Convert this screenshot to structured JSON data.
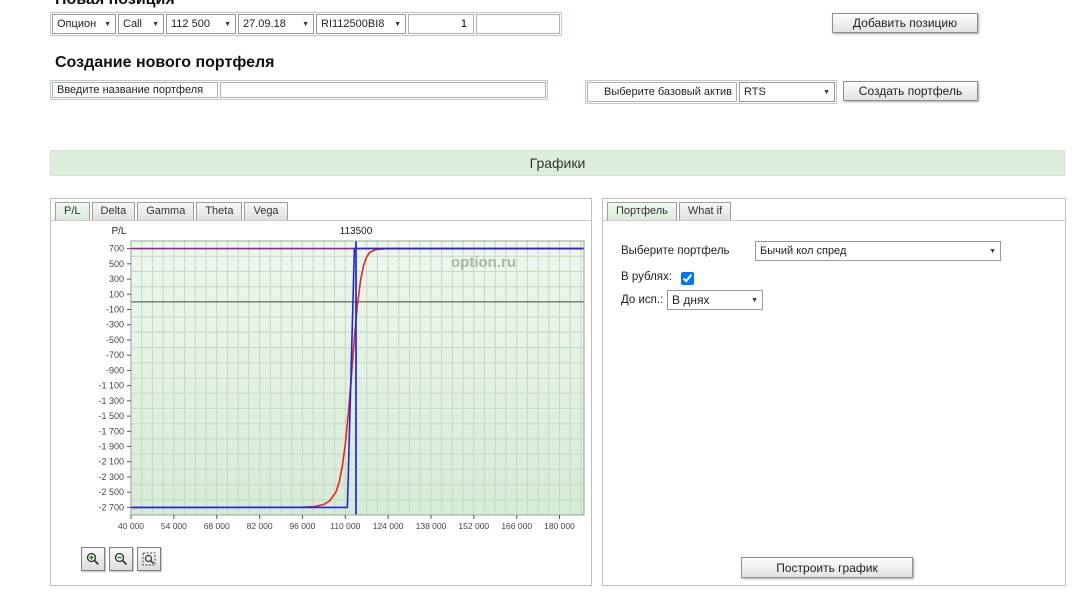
{
  "new_position": {
    "title": "Новая позиция",
    "type": "Опцион",
    "direction": "Call",
    "strike": "112 500",
    "expiry": "27.09.18",
    "code": "RI112500BI8",
    "quantity": "1",
    "add_button": "Добавить позицию"
  },
  "new_portfolio": {
    "title": "Создание нового портфеля",
    "name_label": "Введите название портфеля",
    "name_value": "",
    "base_asset_label": "Выберите базовый актив",
    "base_asset": "RTS",
    "create_button": "Создать портфель"
  },
  "charts_section": {
    "title": "Графики"
  },
  "chart_tabs": [
    "P/L",
    "Delta",
    "Gamma",
    "Theta",
    "Vega"
  ],
  "right_tabs": [
    "Портфель",
    "What if"
  ],
  "portfolio_panel": {
    "select_label": "Выберите портфель",
    "portfolio_value": "Бычий кол спред",
    "rubles_label": "В рублях:",
    "rubles_checked": true,
    "days_label": "До исп.:",
    "days_value": "В днях",
    "build_button": "Построить график"
  },
  "zoom_controls": {
    "zoom_in": "zoom-in",
    "zoom_out": "zoom-out",
    "zoom_box": "zoom-selection"
  },
  "chart_data": {
    "type": "line",
    "ylabel": "P/L",
    "watermark": "option.ru",
    "x_range": [
      40000,
      188000
    ],
    "y_range": [
      -2800,
      800
    ],
    "x_minor_step": 3500,
    "y_step": 200,
    "x_ticks": [
      {
        "v": 40000,
        "label": "40 000"
      },
      {
        "v": 54000,
        "label": "54 000"
      },
      {
        "v": 68000,
        "label": "68 000"
      },
      {
        "v": 82000,
        "label": "82 000"
      },
      {
        "v": 96000,
        "label": "96 000"
      },
      {
        "v": 110000,
        "label": "110 000"
      },
      {
        "v": 124000,
        "label": "124 000"
      },
      {
        "v": 138000,
        "label": "138 000"
      },
      {
        "v": 152000,
        "label": "152 000"
      },
      {
        "v": 166000,
        "label": "166 000"
      },
      {
        "v": 180000,
        "label": "180 000"
      }
    ],
    "y_ticks": [
      {
        "v": 700,
        "label": "700"
      },
      {
        "v": 500,
        "label": "500"
      },
      {
        "v": 300,
        "label": "300"
      },
      {
        "v": 100,
        "label": "100"
      },
      {
        "v": -100,
        "label": "-100"
      },
      {
        "v": -300,
        "label": "-300"
      },
      {
        "v": -500,
        "label": "-500"
      },
      {
        "v": -700,
        "label": "-700"
      },
      {
        "v": -900,
        "label": "-900"
      },
      {
        "v": -1100,
        "label": "-1 100"
      },
      {
        "v": -1300,
        "label": "-1 300"
      },
      {
        "v": -1500,
        "label": "-1 500"
      },
      {
        "v": -1700,
        "label": "-1 700"
      },
      {
        "v": -1900,
        "label": "-1 900"
      },
      {
        "v": -2100,
        "label": "-2 100"
      },
      {
        "v": -2300,
        "label": "-2 300"
      },
      {
        "v": -2500,
        "label": "-2 500"
      },
      {
        "v": -2700,
        "label": "-2 700"
      }
    ],
    "zero_line": 0,
    "marker": {
      "x": 113500,
      "label": "113500",
      "color": "#2233dd"
    },
    "series": [
      {
        "name": "max-profit-line",
        "color": "#a020a0",
        "points": [
          [
            40000,
            700
          ],
          [
            188000,
            700
          ]
        ]
      },
      {
        "name": "current-value",
        "color": "#ee2222",
        "points": [
          [
            40000,
            -2700
          ],
          [
            96000,
            -2697
          ],
          [
            100000,
            -2688
          ],
          [
            103000,
            -2662
          ],
          [
            105000,
            -2610
          ],
          [
            107000,
            -2495
          ],
          [
            108000,
            -2370
          ],
          [
            109000,
            -2170
          ],
          [
            110000,
            -1870
          ],
          [
            111000,
            -1470
          ],
          [
            112000,
            -990
          ],
          [
            113000,
            -470
          ],
          [
            114000,
            -30
          ],
          [
            115000,
            285
          ],
          [
            116000,
            480
          ],
          [
            117000,
            590
          ],
          [
            118000,
            650
          ],
          [
            120000,
            688
          ],
          [
            124000,
            700
          ],
          [
            188000,
            700
          ]
        ]
      },
      {
        "name": "expiration-payoff",
        "color": "#2222ee",
        "points": [
          [
            40000,
            -2700
          ],
          [
            110700,
            -2700
          ],
          [
            113000,
            700
          ],
          [
            188000,
            700
          ]
        ]
      }
    ]
  }
}
